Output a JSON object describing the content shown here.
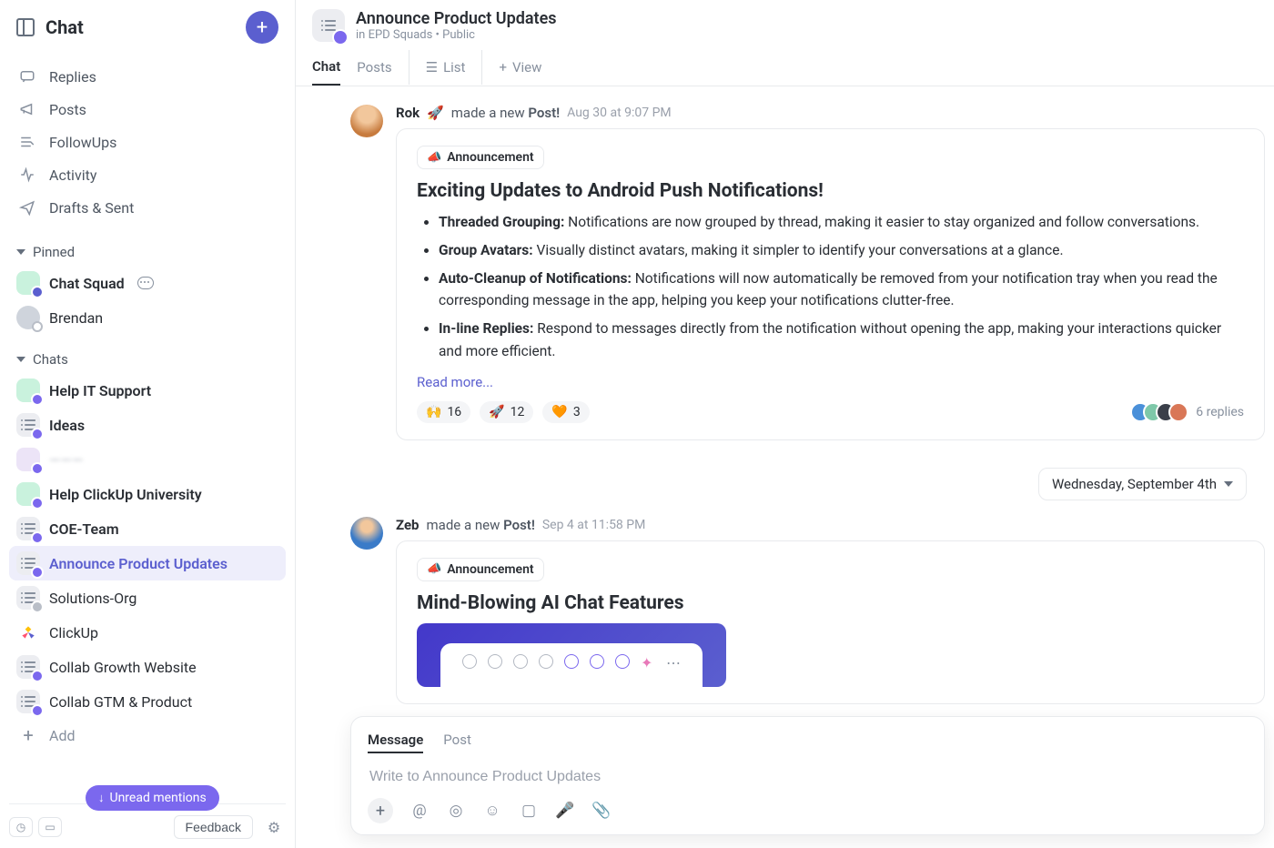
{
  "sidebar": {
    "title": "Chat",
    "nav": [
      {
        "label": "Replies"
      },
      {
        "label": "Posts"
      },
      {
        "label": "FollowUps"
      },
      {
        "label": "Activity"
      },
      {
        "label": "Drafts & Sent"
      }
    ],
    "pinned_label": "Pinned",
    "pinned": [
      {
        "label": "Chat Squad"
      },
      {
        "label": "Brendan"
      }
    ],
    "chats_label": "Chats",
    "chats": [
      {
        "label": "Help IT Support"
      },
      {
        "label": "Ideas"
      },
      {
        "label": "———"
      },
      {
        "label": "Help ClickUp University"
      },
      {
        "label": "COE-Team"
      },
      {
        "label": "Announce Product Updates"
      },
      {
        "label": "Solutions-Org"
      },
      {
        "label": "ClickUp"
      },
      {
        "label": "Collab Growth Website"
      },
      {
        "label": "Collab GTM & Product"
      }
    ],
    "add_label": "Add",
    "unread_label": "Unread mentions",
    "feedback": "Feedback"
  },
  "header": {
    "title": "Announce Product Updates",
    "sub_prefix": "in ",
    "space": "EPD Squads",
    "sep": " • ",
    "vis": "Public",
    "tabs": {
      "chat": "Chat",
      "posts": "Posts",
      "list": "List",
      "view": "View"
    }
  },
  "posts": [
    {
      "name": "Rok",
      "rocket": "🚀",
      "action_pre": "made a new ",
      "action_b": "Post!",
      "time": "Aug 30 at 9:07 PM",
      "ann": "Announcement",
      "title": "Exciting Updates to Android Push Notifications!",
      "bullets": [
        {
          "b": "Threaded Grouping:",
          "t": " Notifications are now grouped by thread, making it easier to stay organized and follow conversations."
        },
        {
          "b": "Group Avatars:",
          "t": " Visually distinct avatars, making it simpler to identify your conversations at a glance."
        },
        {
          "b": "Auto-Cleanup of Notifications:",
          "t": " Notifications will now automatically be removed from your notification tray when you read the corresponding message in the app, helping you keep your notifications clutter-free."
        },
        {
          "b": "In-line Replies:",
          "t": " Respond to messages directly from the notification without opening the app, making your interactions quicker and more efficient."
        }
      ],
      "readmore": "Read more...",
      "reactions": [
        {
          "e": "🙌",
          "c": "16"
        },
        {
          "e": "🚀",
          "c": "12"
        },
        {
          "e": "🧡",
          "c": "3"
        }
      ],
      "replies": "6 replies"
    },
    {
      "name": "Zeb",
      "action_pre": "made a new ",
      "action_b": "Post!",
      "time": "Sep 4 at 11:58 PM",
      "ann": "Announcement",
      "title": "Mind-Blowing AI Chat Features"
    }
  ],
  "date_sep": "Wednesday, September 4th",
  "composer": {
    "tab_message": "Message",
    "tab_post": "Post",
    "placeholder": "Write to Announce Product Updates"
  }
}
